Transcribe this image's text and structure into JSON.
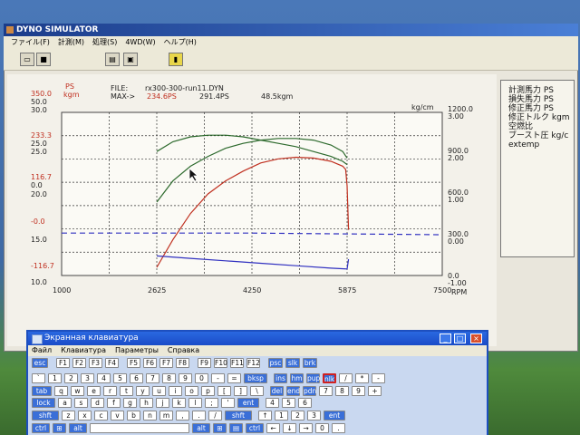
{
  "window": {
    "title": "DYNO SIMULATOR"
  },
  "menu": [
    "ファイル(F)",
    "計測(M)",
    "処理(S)",
    "4WD(W)",
    "ヘルプ(H)"
  ],
  "toolbar": {
    "icons": [
      "open-folder-icon",
      "save-disk-icon",
      "print-icon",
      "monitor-icon",
      "exit-icon"
    ]
  },
  "file_info": {
    "file_label": "FILE:",
    "file_name": "rx300-300-run11.DYN",
    "max_label": "MAX->",
    "max_ps": "234.6PS",
    "max_ps2": "291.4PS",
    "max_kgm": "48.5kgm"
  },
  "left_axis": {
    "unit_ps": "PS",
    "unit_kgm": "kgm",
    "lines": [
      {
        "text": "350.0",
        "color": "red"
      },
      {
        "text": "50.0",
        "color": "blk"
      },
      {
        "text": "30.0",
        "color": "blk"
      },
      {
        "text": "233.3",
        "color": "red"
      },
      {
        "text": "25.0",
        "color": "blk"
      },
      {
        "text": "25.0",
        "color": "blk"
      },
      {
        "text": "116.7",
        "color": "red"
      },
      {
        "text": "0.0",
        "color": "blk"
      },
      {
        "text": "20.0",
        "color": "blk"
      },
      {
        "text": "-0.0",
        "color": "red"
      },
      {
        "text": "15.0",
        "color": "blk"
      },
      {
        "text": "-116.7",
        "color": "red"
      },
      {
        "text": "10.0",
        "color": "blk"
      }
    ]
  },
  "right_axis": {
    "unit": "kg/cm",
    "lines": [
      "1200.0",
      "3.00",
      "900.0",
      "2.00",
      "600.0",
      "1.00",
      "300.0",
      "0.00",
      "0.0",
      "-1.00"
    ]
  },
  "x_axis": {
    "ticks": [
      "1000",
      "2625",
      "4250",
      "5875",
      "7500"
    ],
    "unit": "RPM"
  },
  "legend": [
    "計測馬力 PS",
    "損失馬力 PS",
    "修正馬力 PS",
    "修正トルク kgm",
    "空燃比",
    "ブースト圧 kg/c",
    "extemp"
  ],
  "chart_data": {
    "type": "line",
    "x_range": [
      1000,
      7500
    ],
    "series": [
      {
        "name": "",
        "color": "#c03020",
        "x": [
          2625,
          2900,
          3200,
          3500,
          3800,
          4100,
          4400,
          4700,
          5000,
          5300,
          5600,
          5800,
          5850,
          5875,
          5900
        ],
        "y": [
          0.05,
          0.22,
          0.38,
          0.5,
          0.58,
          0.64,
          0.69,
          0.715,
          0.725,
          0.72,
          0.7,
          0.67,
          0.65,
          0.55,
          0.28
        ]
      },
      {
        "name": "",
        "color": "#2d6a2d",
        "x": [
          2625,
          2900,
          3200,
          3500,
          3800,
          4100,
          4400,
          4700,
          5000,
          5300,
          5600,
          5800,
          5875
        ],
        "y": [
          0.45,
          0.58,
          0.67,
          0.73,
          0.78,
          0.81,
          0.83,
          0.84,
          0.84,
          0.83,
          0.8,
          0.76,
          0.72
        ]
      },
      {
        "name": "",
        "color": "#2d6a2d",
        "x": [
          2625,
          2900,
          3200,
          3500,
          3800,
          4100,
          4400,
          4700,
          5000,
          5300,
          5600,
          5800,
          5875
        ],
        "y": [
          0.76,
          0.82,
          0.85,
          0.86,
          0.86,
          0.85,
          0.83,
          0.81,
          0.79,
          0.76,
          0.73,
          0.7,
          0.68
        ]
      },
      {
        "name": "",
        "color": "#3030c0",
        "dashed": true,
        "x": [
          1000,
          2625,
          4250,
          5875,
          7500
        ],
        "y": [
          0.26,
          0.26,
          0.26,
          0.255,
          0.25
        ]
      },
      {
        "name": "",
        "color": "#3030c0",
        "x": [
          2625,
          3200,
          3800,
          4400,
          5000,
          5600,
          5875,
          5900
        ],
        "y": [
          0.12,
          0.105,
          0.09,
          0.075,
          0.06,
          0.045,
          0.04,
          0.1
        ]
      }
    ]
  },
  "osk": {
    "title": "Экранная клавиатура",
    "menu": [
      "Файл",
      "Клавиатура",
      "Параметры",
      "Справка"
    ],
    "window_buttons": [
      "_",
      "□",
      "×"
    ],
    "rows": [
      [
        "esc",
        "F1",
        "F2",
        "F3",
        "F4",
        "F5",
        "F6",
        "F7",
        "F8",
        "F9",
        "F10",
        "F11",
        "F12",
        "psc",
        "slk",
        "brk"
      ],
      [
        "`",
        "1",
        "2",
        "3",
        "4",
        "5",
        "6",
        "7",
        "8",
        "9",
        "0",
        "-",
        "=",
        "bksp",
        "ins",
        "hm",
        "pup",
        "nlk",
        "/",
        "*",
        "-"
      ],
      [
        "tab",
        "q",
        "w",
        "e",
        "r",
        "t",
        "y",
        "u",
        "i",
        "o",
        "p",
        "[",
        "]",
        "\\",
        "del",
        "end",
        "pdn",
        "7",
        "8",
        "9",
        "+"
      ],
      [
        "lock",
        "a",
        "s",
        "d",
        "f",
        "g",
        "h",
        "j",
        "k",
        "l",
        ";",
        "'",
        "ent",
        "4",
        "5",
        "6"
      ],
      [
        "shft",
        "z",
        "x",
        "c",
        "v",
        "b",
        "n",
        "m",
        ",",
        ".",
        "/",
        "shft",
        "↑",
        "1",
        "2",
        "3",
        "ent"
      ],
      [
        "ctrl",
        "⊞",
        "alt",
        "",
        "alt",
        "⊞",
        "▤",
        "ctrl",
        "←",
        "↓",
        "→",
        "0",
        "."
      ]
    ]
  }
}
